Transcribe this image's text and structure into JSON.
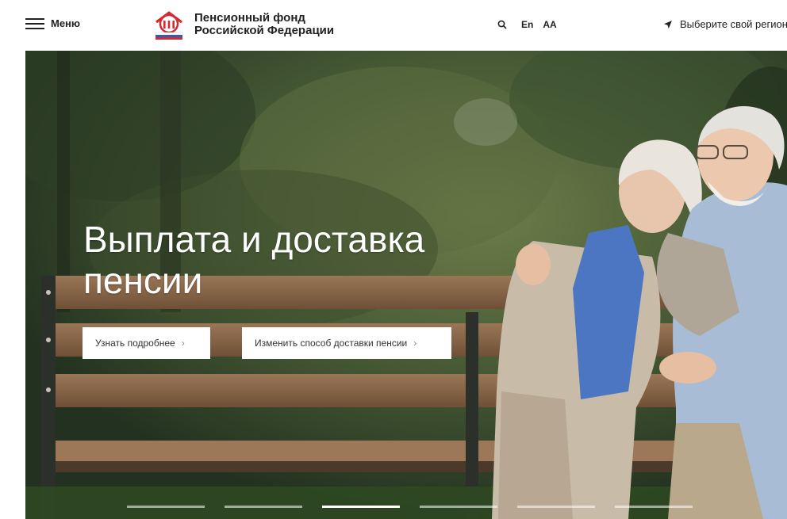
{
  "header": {
    "menu_label": "Меню",
    "logo_line1": "Пенсионный фонд",
    "logo_line2": "Российской Федерации",
    "lang_label": "En",
    "accessibility_label": "AA",
    "region_label": "Выберите свой регион"
  },
  "hero": {
    "title": "Выплата и доставка пенсии",
    "learn_more_label": "Узнать подробнее",
    "change_delivery_label": "Изменить способ доставки пенсии",
    "chevron": "›"
  },
  "slider": {
    "count": 6,
    "active_index": 2
  },
  "colors": {
    "logo_red": "#d7282f",
    "logo_blue": "#2f5fa8",
    "text_dark": "#222222"
  }
}
